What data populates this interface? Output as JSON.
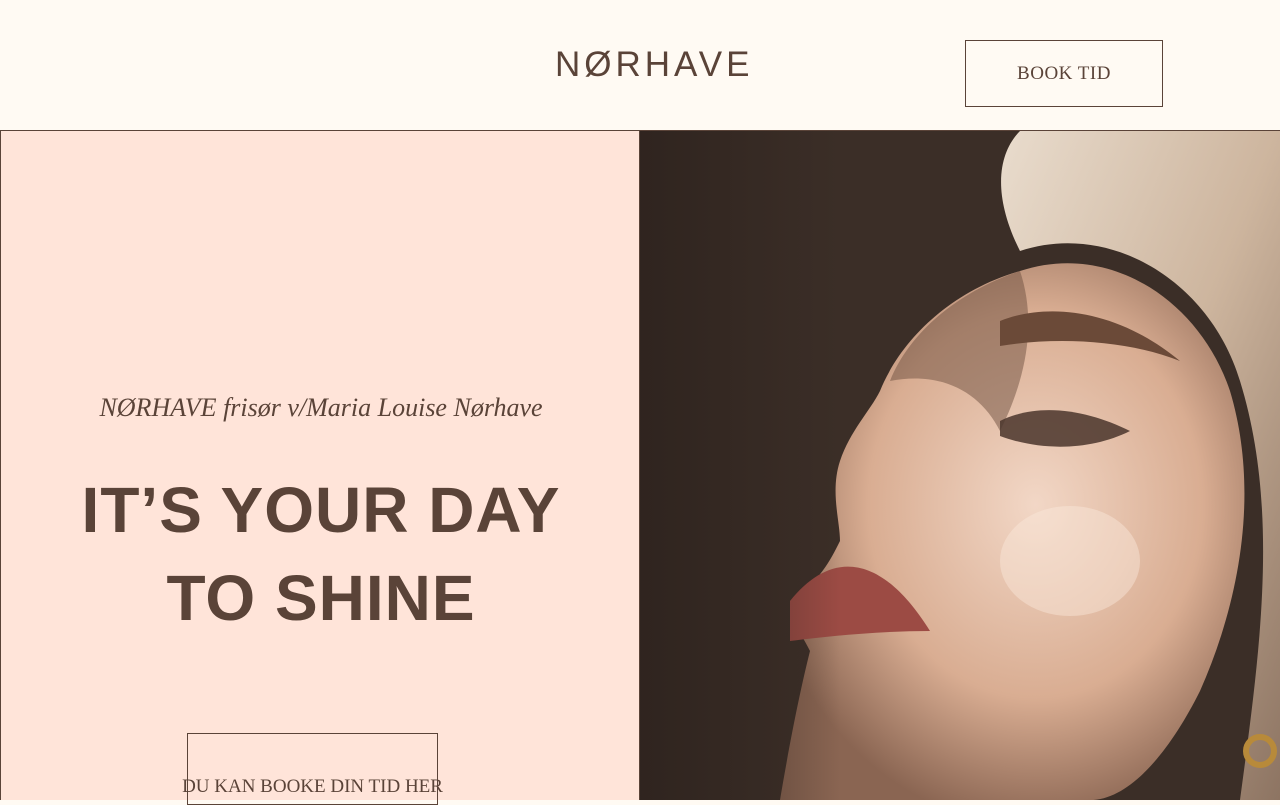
{
  "header": {
    "logo": "NØRHAVE",
    "book_button": "BOOK TID"
  },
  "hero": {
    "subtitle": "NØRHAVE frisør v/Maria Louise Nørhave",
    "headline_line1": "IT’S YOUR DAY",
    "headline_line2": "TO SHINE",
    "cta_button": "DU KAN BOOKE DIN TID HER"
  },
  "colors": {
    "header_bg": "#fffaf3",
    "hero_left_bg": "#ffe4d9",
    "text": "#5a4338"
  }
}
